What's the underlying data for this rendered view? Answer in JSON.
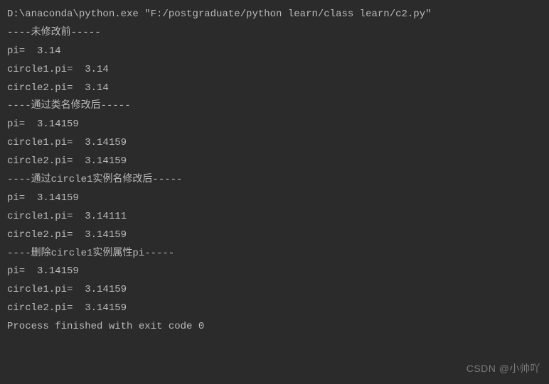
{
  "console": {
    "lines": [
      "D:\\anaconda\\python.exe \"F:/postgraduate/python learn/class learn/c2.py\"",
      "----未修改前-----",
      "pi=  3.14",
      "circle1.pi=  3.14",
      "circle2.pi=  3.14",
      "----通过类名修改后-----",
      "pi=  3.14159",
      "circle1.pi=  3.14159",
      "circle2.pi=  3.14159",
      "----通过circle1实例名修改后-----",
      "pi=  3.14159",
      "circle1.pi=  3.14111",
      "circle2.pi=  3.14159",
      "----删除circle1实例属性pi-----",
      "pi=  3.14159",
      "circle1.pi=  3.14159",
      "circle2.pi=  3.14159",
      "",
      "Process finished with exit code 0"
    ]
  },
  "watermark": "CSDN @小帅吖"
}
